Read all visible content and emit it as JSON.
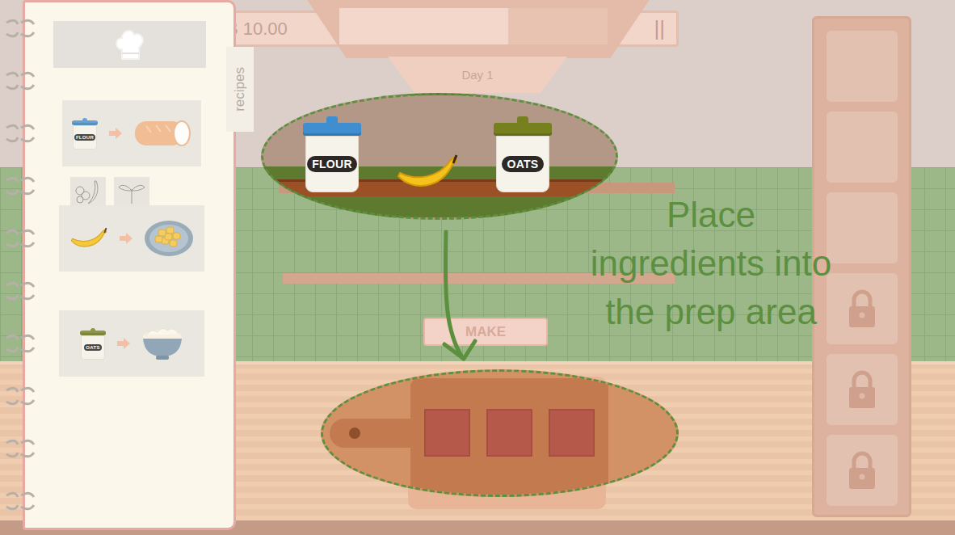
{
  "recipe_book": {
    "tab": "recipes",
    "recipes": [
      {
        "input": {
          "kind": "jar",
          "label": "FLOUR",
          "color": "#4a94d2"
        },
        "output": "bread"
      },
      {
        "input": {
          "kind": "banana",
          "label": "",
          "color": "#f4c21a"
        },
        "output": "banana-fritters"
      },
      {
        "input": {
          "kind": "jar",
          "label": "OATS",
          "color": "#7a8426"
        },
        "output": "porridge"
      }
    ],
    "filters": [
      {
        "kind": "fruit",
        "selected": false
      },
      {
        "kind": "herb",
        "selected": false
      }
    ]
  },
  "hud": {
    "money": "B 10.00",
    "pause": "||",
    "day": "Day 1",
    "day_progress": {
      "level": 0.63
    }
  },
  "shelf": {
    "items": [
      {
        "kind": "jar",
        "label": "FLOUR",
        "color": "#3f8fd0"
      },
      {
        "kind": "banana",
        "label": "",
        "color": "#f4c21a"
      },
      {
        "kind": "jar",
        "label": "OATS",
        "color": "#77801f"
      }
    ]
  },
  "prep_area": {
    "slots": [
      {
        "filled": false
      },
      {
        "filled": false
      },
      {
        "filled": false
      }
    ]
  },
  "make_button": {
    "label": "MAKE",
    "disabled": true
  },
  "tutorial": {
    "lines": [
      "Place",
      "ingredients into",
      "the prep area"
    ]
  },
  "inventory": {
    "slots": [
      {
        "locked": false
      },
      {
        "locked": false
      },
      {
        "locked": false
      },
      {
        "locked": true
      },
      {
        "locked": true
      },
      {
        "locked": true
      }
    ]
  }
}
